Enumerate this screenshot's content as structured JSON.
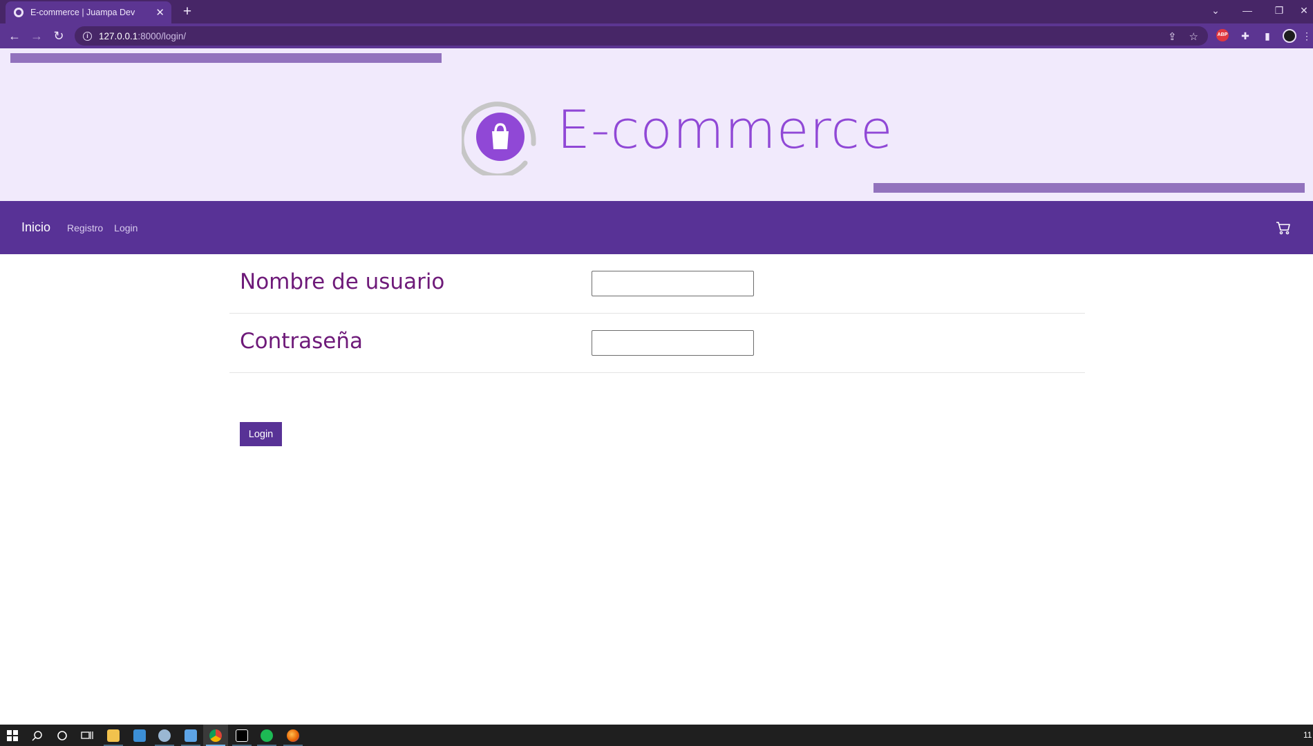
{
  "browser": {
    "tab_title": "E-commerce | Juampa Dev",
    "close_glyph": "✕",
    "new_tab_glyph": "+",
    "url_host": "127.0.0.1",
    "url_rest": ":8000/login/",
    "extension_abp": "ABP"
  },
  "header": {
    "brand": "E-commerce",
    "accent_color": "#9048d6",
    "bar_color": "#9272bd"
  },
  "navbar": {
    "brand": "Inicio",
    "links": [
      "Registro",
      "Login"
    ],
    "background": "#583296"
  },
  "form": {
    "username_label": "Nombre de usuario",
    "username_value": "",
    "password_label": "Contraseña",
    "password_value": "",
    "submit_label": "Login"
  },
  "taskbar": {
    "clock_text": "11"
  }
}
